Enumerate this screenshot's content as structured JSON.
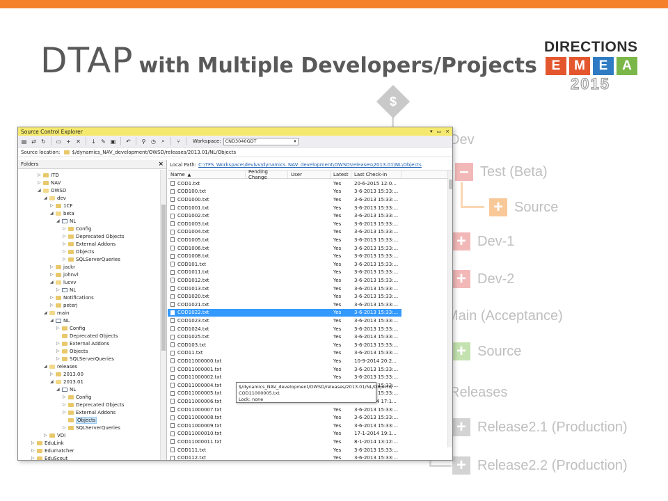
{
  "slide": {
    "title_main": "DTAP",
    "title_sub": "with Multiple Developers/Projects"
  },
  "logo": {
    "word": "DIRECTIONS",
    "letters": [
      {
        "ch": "E",
        "color": "#e4572e"
      },
      {
        "ch": "M",
        "color": "#e4572e"
      },
      {
        "ch": "E",
        "color": "#2e7bc4"
      },
      {
        "ch": "A",
        "color": "#7ab648"
      }
    ],
    "year": "2015"
  },
  "root_symbol": "$",
  "tree_items": [
    {
      "label": "Dev",
      "sign": "",
      "color": "none"
    },
    {
      "label": "Test (Beta)",
      "sign": "–",
      "color": "red"
    },
    {
      "label": "Source",
      "sign": "+",
      "color": "orange"
    },
    {
      "label": "Dev-1",
      "sign": "+",
      "color": "red"
    },
    {
      "label": "Dev-2",
      "sign": "+",
      "color": "red"
    },
    {
      "label": "Main (Acceptance)",
      "sign": "",
      "color": "none"
    },
    {
      "label": "Source",
      "sign": "+",
      "color": "green"
    },
    {
      "label": "Releases",
      "sign": "",
      "color": "none"
    },
    {
      "label": "Release2.1 (Production)",
      "sign": "+",
      "color": "grey"
    },
    {
      "label": "Release2.2 (Production)",
      "sign": "+",
      "color": "grey"
    }
  ],
  "sce": {
    "title": "Source Control Explorer",
    "controls": [
      "▾",
      "▭",
      "×"
    ],
    "workspace_label": "Workspace:",
    "workspace_value": "CND3040GDT",
    "source_location_label": "Source location:",
    "source_location_value": "$/dynamics_NAV_development/OWSD/releases/2013.01/NL/Objects",
    "folders_header": "Folders",
    "close_glyph": "×",
    "local_path_label": "Local Path:",
    "local_path_value": "C:\\TFS_Workspace\\devlvv\\dynamics_NAV_development\\OWSD\\releases\\2013.01\\NL\\Objects",
    "columns": [
      "Name",
      "Pending Change",
      "User",
      "Latest",
      "Last Check-in"
    ],
    "folder_tree": [
      {
        "label": "ITD",
        "indent": 0,
        "arrow": "▷",
        "icon": "folder"
      },
      {
        "label": "NAV",
        "indent": 0,
        "arrow": "▷",
        "icon": "folder"
      },
      {
        "label": "OWSD",
        "indent": 0,
        "arrow": "◢",
        "icon": "folder-open"
      },
      {
        "label": "dev",
        "indent": 1,
        "arrow": "◢",
        "icon": "folder-open"
      },
      {
        "label": "1CF",
        "indent": 2,
        "arrow": "▷",
        "icon": "folder"
      },
      {
        "label": "beta",
        "indent": 2,
        "arrow": "◢",
        "icon": "folder-open"
      },
      {
        "label": "NL",
        "indent": 3,
        "arrow": "◢",
        "icon": "workspace"
      },
      {
        "label": "Config",
        "indent": 4,
        "arrow": "▷",
        "icon": "folder"
      },
      {
        "label": "Deprecated Objects",
        "indent": 4,
        "arrow": "▷",
        "icon": "folder"
      },
      {
        "label": "External Addons",
        "indent": 4,
        "arrow": "▷",
        "icon": "folder"
      },
      {
        "label": "Objects",
        "indent": 4,
        "arrow": "▷",
        "icon": "folder"
      },
      {
        "label": "SQLServerQueries",
        "indent": 4,
        "arrow": "▷",
        "icon": "folder"
      },
      {
        "label": "jackr",
        "indent": 2,
        "arrow": "▷",
        "icon": "folder"
      },
      {
        "label": "johnvl",
        "indent": 2,
        "arrow": "▷",
        "icon": "folder"
      },
      {
        "label": "lucvv",
        "indent": 2,
        "arrow": "◢",
        "icon": "folder-open"
      },
      {
        "label": "NL",
        "indent": 3,
        "arrow": "▷",
        "icon": "workspace"
      },
      {
        "label": "Notifications",
        "indent": 2,
        "arrow": "▷",
        "icon": "folder"
      },
      {
        "label": "peterj",
        "indent": 2,
        "arrow": "▷",
        "icon": "folder"
      },
      {
        "label": "main",
        "indent": 1,
        "arrow": "◢",
        "icon": "folder-open"
      },
      {
        "label": "NL",
        "indent": 2,
        "arrow": "◢",
        "icon": "workspace"
      },
      {
        "label": "Config",
        "indent": 3,
        "arrow": "▷",
        "icon": "folder"
      },
      {
        "label": "Deprecated Objects",
        "indent": 3,
        "arrow": "",
        "icon": "folder"
      },
      {
        "label": "External Addons",
        "indent": 3,
        "arrow": "▷",
        "icon": "folder"
      },
      {
        "label": "Objects",
        "indent": 3,
        "arrow": "▷",
        "icon": "folder"
      },
      {
        "label": "SQLServerQueries",
        "indent": 3,
        "arrow": "▷",
        "icon": "folder"
      },
      {
        "label": "releases",
        "indent": 1,
        "arrow": "◢",
        "icon": "folder-open"
      },
      {
        "label": "2013.00",
        "indent": 2,
        "arrow": "▷",
        "icon": "folder"
      },
      {
        "label": "2013.01",
        "indent": 2,
        "arrow": "◢",
        "icon": "folder-open"
      },
      {
        "label": "NL",
        "indent": 3,
        "arrow": "◢",
        "icon": "workspace"
      },
      {
        "label": "Config",
        "indent": 4,
        "arrow": "▷",
        "icon": "folder"
      },
      {
        "label": "Deprecated Objects",
        "indent": 4,
        "arrow": "▷",
        "icon": "folder"
      },
      {
        "label": "External Addons",
        "indent": 4,
        "arrow": "▷",
        "icon": "folder"
      },
      {
        "label": "Objects",
        "indent": 4,
        "arrow": "",
        "icon": "folder",
        "selected": true
      },
      {
        "label": "SQLServerQueries",
        "indent": 4,
        "arrow": "▷",
        "icon": "folder"
      },
      {
        "label": "VDI",
        "indent": 1,
        "arrow": "▷",
        "icon": "folder"
      },
      {
        "label": "EduLink",
        "indent": -1,
        "arrow": "▷",
        "icon": "folder"
      },
      {
        "label": "Edumatcher",
        "indent": -1,
        "arrow": "▷",
        "icon": "folder"
      },
      {
        "label": "EduScout",
        "indent": -1,
        "arrow": "▷",
        "icon": "folder"
      }
    ],
    "files": [
      [
        "COD1.txt",
        "Yes",
        "20-6-2015 12:0..."
      ],
      [
        "COD100.txt",
        "Yes",
        "3-6-2013 15:33:..."
      ],
      [
        "COD1000.txt",
        "Yes",
        "3-6-2013 15:33:..."
      ],
      [
        "COD1001.txt",
        "Yes",
        "3-6-2013 15:33:..."
      ],
      [
        "COD1002.txt",
        "Yes",
        "3-6-2013 15:33:..."
      ],
      [
        "COD1003.txt",
        "Yes",
        "3-6-2013 15:33:..."
      ],
      [
        "COD1004.txt",
        "Yes",
        "3-6-2013 15:33:..."
      ],
      [
        "COD1005.txt",
        "Yes",
        "3-6-2013 15:33:..."
      ],
      [
        "COD1006.txt",
        "Yes",
        "3-6-2013 15:33:..."
      ],
      [
        "COD1008.txt",
        "Yes",
        "3-6-2013 15:33:..."
      ],
      [
        "COD101.txt",
        "Yes",
        "3-6-2013 15:33:..."
      ],
      [
        "COD1011.txt",
        "Yes",
        "3-6-2013 15:33:..."
      ],
      [
        "COD1012.txt",
        "Yes",
        "3-6-2013 15:33:..."
      ],
      [
        "COD1013.txt",
        "Yes",
        "3-6-2013 15:33:..."
      ],
      [
        "COD1020.txt",
        "Yes",
        "3-6-2013 15:33:..."
      ],
      [
        "COD1021.txt",
        "Yes",
        "3-6-2013 15:33:..."
      ],
      [
        "COD1022.txt",
        "Yes",
        "3-6-2013 15:33:..."
      ],
      [
        "COD1023.txt",
        "Yes",
        "3-6-2013 15:33:..."
      ],
      [
        "COD1024.txt",
        "Yes",
        "3-6-2013 15:33:..."
      ],
      [
        "COD1025.txt",
        "Yes",
        "3-6-2013 15:33:..."
      ],
      [
        "COD103.txt",
        "Yes",
        "3-6-2013 15:33:..."
      ],
      [
        "COD11.txt",
        "Yes",
        "3-6-2013 15:33:..."
      ],
      [
        "COD11000000.txt",
        "Yes",
        "10-9-2014 20:2..."
      ],
      [
        "COD11000001.txt",
        "Yes",
        "3-6-2013 15:33:..."
      ],
      [
        "COD11000002.txt",
        "Yes",
        "3-6-2013 15:33:..."
      ],
      [
        "COD11000004.txt",
        "Yes",
        "3-6-2013 15:33:..."
      ],
      [
        "COD11000005.txt",
        "Yes",
        "3-6-2013 15:33:..."
      ],
      [
        "COD11000006.txt",
        "Yes",
        "31-7-2014 17:1..."
      ],
      [
        "COD11000007.txt",
        "Yes",
        "3-6-2013 15:33:..."
      ],
      [
        "COD11000008.txt",
        "Yes",
        "3-6-2013 15:33:..."
      ],
      [
        "COD11000009.txt",
        "Yes",
        "3-6-2013 15:33:..."
      ],
      [
        "COD11000010.txt",
        "Yes",
        "17-1-2014 19:1..."
      ],
      [
        "COD11000011.txt",
        "Yes",
        "8-1-2014 13:12:..."
      ],
      [
        "COD111.txt",
        "Yes",
        "3-6-2013 15:33:..."
      ],
      [
        "COD112.txt",
        "Yes",
        "3-6-2013 15:33:..."
      ]
    ],
    "selected_file": "COD1022.txt",
    "tooltip_line1": "$/dynamics_NAV_development/OWSD/releases/2013.01/NL/Objects/",
    "tooltip_line2": "COD11000005.txt",
    "tooltip_line3": "Lock: none"
  }
}
